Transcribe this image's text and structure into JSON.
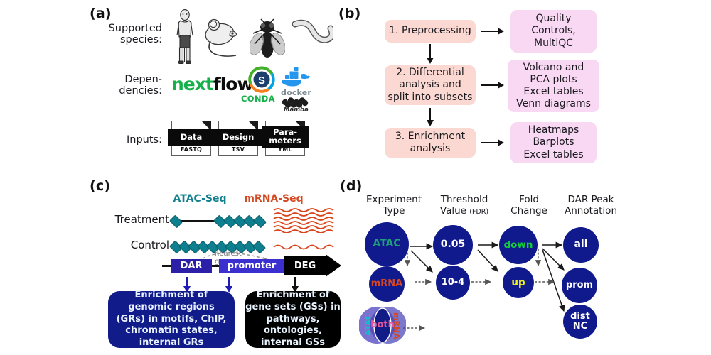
{
  "figure": {
    "panels": {
      "a": "(a)",
      "b": "(b)",
      "c": "(c)",
      "d": "(d)"
    }
  },
  "panel_a": {
    "rows": {
      "species_label": "Supported\nspecies:",
      "species_label_line1": "Supported",
      "species_label_line2": "species:",
      "dependencies_label_line1": "Depen-",
      "dependencies_label_line2": "dencies:",
      "inputs_label": "Inputs:"
    },
    "species": [
      {
        "name": "human",
        "icon": "human-icon"
      },
      {
        "name": "mouse",
        "icon": "mouse-icon"
      },
      {
        "name": "fly",
        "icon": "fly-icon"
      },
      {
        "name": "worm",
        "icon": "worm-icon"
      }
    ],
    "dependencies": [
      {
        "name": "nextflow",
        "part1": "next",
        "part2": "flow"
      },
      {
        "name": "conda",
        "label": "CONDA"
      },
      {
        "name": "docker",
        "label": "docker"
      },
      {
        "name": "mamba",
        "label": "Mamba"
      }
    ],
    "inputs": [
      {
        "title": "Data",
        "ext": "FASTQ"
      },
      {
        "title": "Design",
        "ext": "TSV"
      },
      {
        "title_line1": "Para-",
        "title_line2": "meters",
        "ext": "YML"
      }
    ]
  },
  "panel_b": {
    "steps": [
      {
        "label": "1. Preprocessing"
      },
      {
        "label": "2. Differential\nanalysis and\nsplit into subsets"
      },
      {
        "label": "3. Enrichment\nanalysis"
      }
    ],
    "outputs": [
      {
        "label": "Quality\nControls,\nMultiQC"
      },
      {
        "label": "Volcano and\nPCA plots\nExcel tables\nVenn diagrams"
      },
      {
        "label": "Heatmaps\nBarplots\nExcel tables"
      }
    ],
    "colors": {
      "step_box": "#fbd8d1",
      "output_box": "#f9d8f4",
      "arrow": "#111111"
    }
  },
  "panel_c": {
    "assay_titles": [
      {
        "label": "ATAC-Seq",
        "color": "#13808f"
      },
      {
        "label": "mRNA-Seq",
        "color": "#d44a22"
      }
    ],
    "row_labels": [
      "Treatment",
      "Control"
    ],
    "gene_segments": [
      {
        "label": "DAR",
        "color": "#2c20a8"
      },
      {
        "label": "promoter",
        "color": "#3b2fd0"
      },
      {
        "label": "DEG",
        "color": "#000000"
      }
    ],
    "nearest_gene_label": "nearest gene",
    "result_boxes": [
      {
        "label": "Enrichment of\ngenomic regions\n(GRs) in motifs, ChIP,\nchromatin states,\ninternal GRs",
        "bg": "#111b8a"
      },
      {
        "label": "Enrichment of\ngene sets (GSs) in\npathways,\nontologies,\ninternal GSs",
        "bg": "#000000"
      }
    ],
    "peak_color": "#0d7f8e",
    "treatment_peaks_x": [
      0,
      64,
      78,
      92,
      106
    ],
    "control_peaks_x": [
      0,
      13,
      26,
      39,
      52,
      65,
      78,
      91,
      104
    ]
  },
  "panel_d": {
    "headers": [
      {
        "line1": "Experiment",
        "line2": "Type",
        "small": ""
      },
      {
        "line1": "Threshold",
        "line2": "Value",
        "small": "(FDR)"
      },
      {
        "line1": "Fold",
        "line2": "Change",
        "small": ""
      },
      {
        "line1": "DAR Peak",
        "line2": "Annotation",
        "small": ""
      }
    ],
    "columns": [
      {
        "name": "experiment-type",
        "nodes": [
          {
            "label": "ATAC",
            "color": "#1e9e7a"
          },
          {
            "label": "mRNA",
            "color": "#d8461f"
          },
          {
            "label": "both",
            "color": "#e0559b",
            "type": "venn",
            "venn_left": "ATAC",
            "venn_right": "mRNA",
            "venn_left_color": "#13808f",
            "venn_right_color": "#d44a22"
          }
        ]
      },
      {
        "name": "threshold-value",
        "nodes": [
          {
            "label": "0.05",
            "color": "#ffffff"
          },
          {
            "label": "10-4",
            "color": "#ffffff"
          }
        ]
      },
      {
        "name": "fold-change",
        "nodes": [
          {
            "label": "down",
            "color": "#12cc3b"
          },
          {
            "label": "up",
            "color": "#f2f216"
          }
        ]
      },
      {
        "name": "dar-peak-annotation",
        "nodes": [
          {
            "label": "all",
            "color": "#ffffff"
          },
          {
            "label": "prom",
            "color": "#ffffff"
          },
          {
            "label": "dist\nNC",
            "line1": "dist",
            "line2": "NC",
            "color": "#ffffff"
          }
        ]
      }
    ],
    "node_color": "#101a8c"
  }
}
